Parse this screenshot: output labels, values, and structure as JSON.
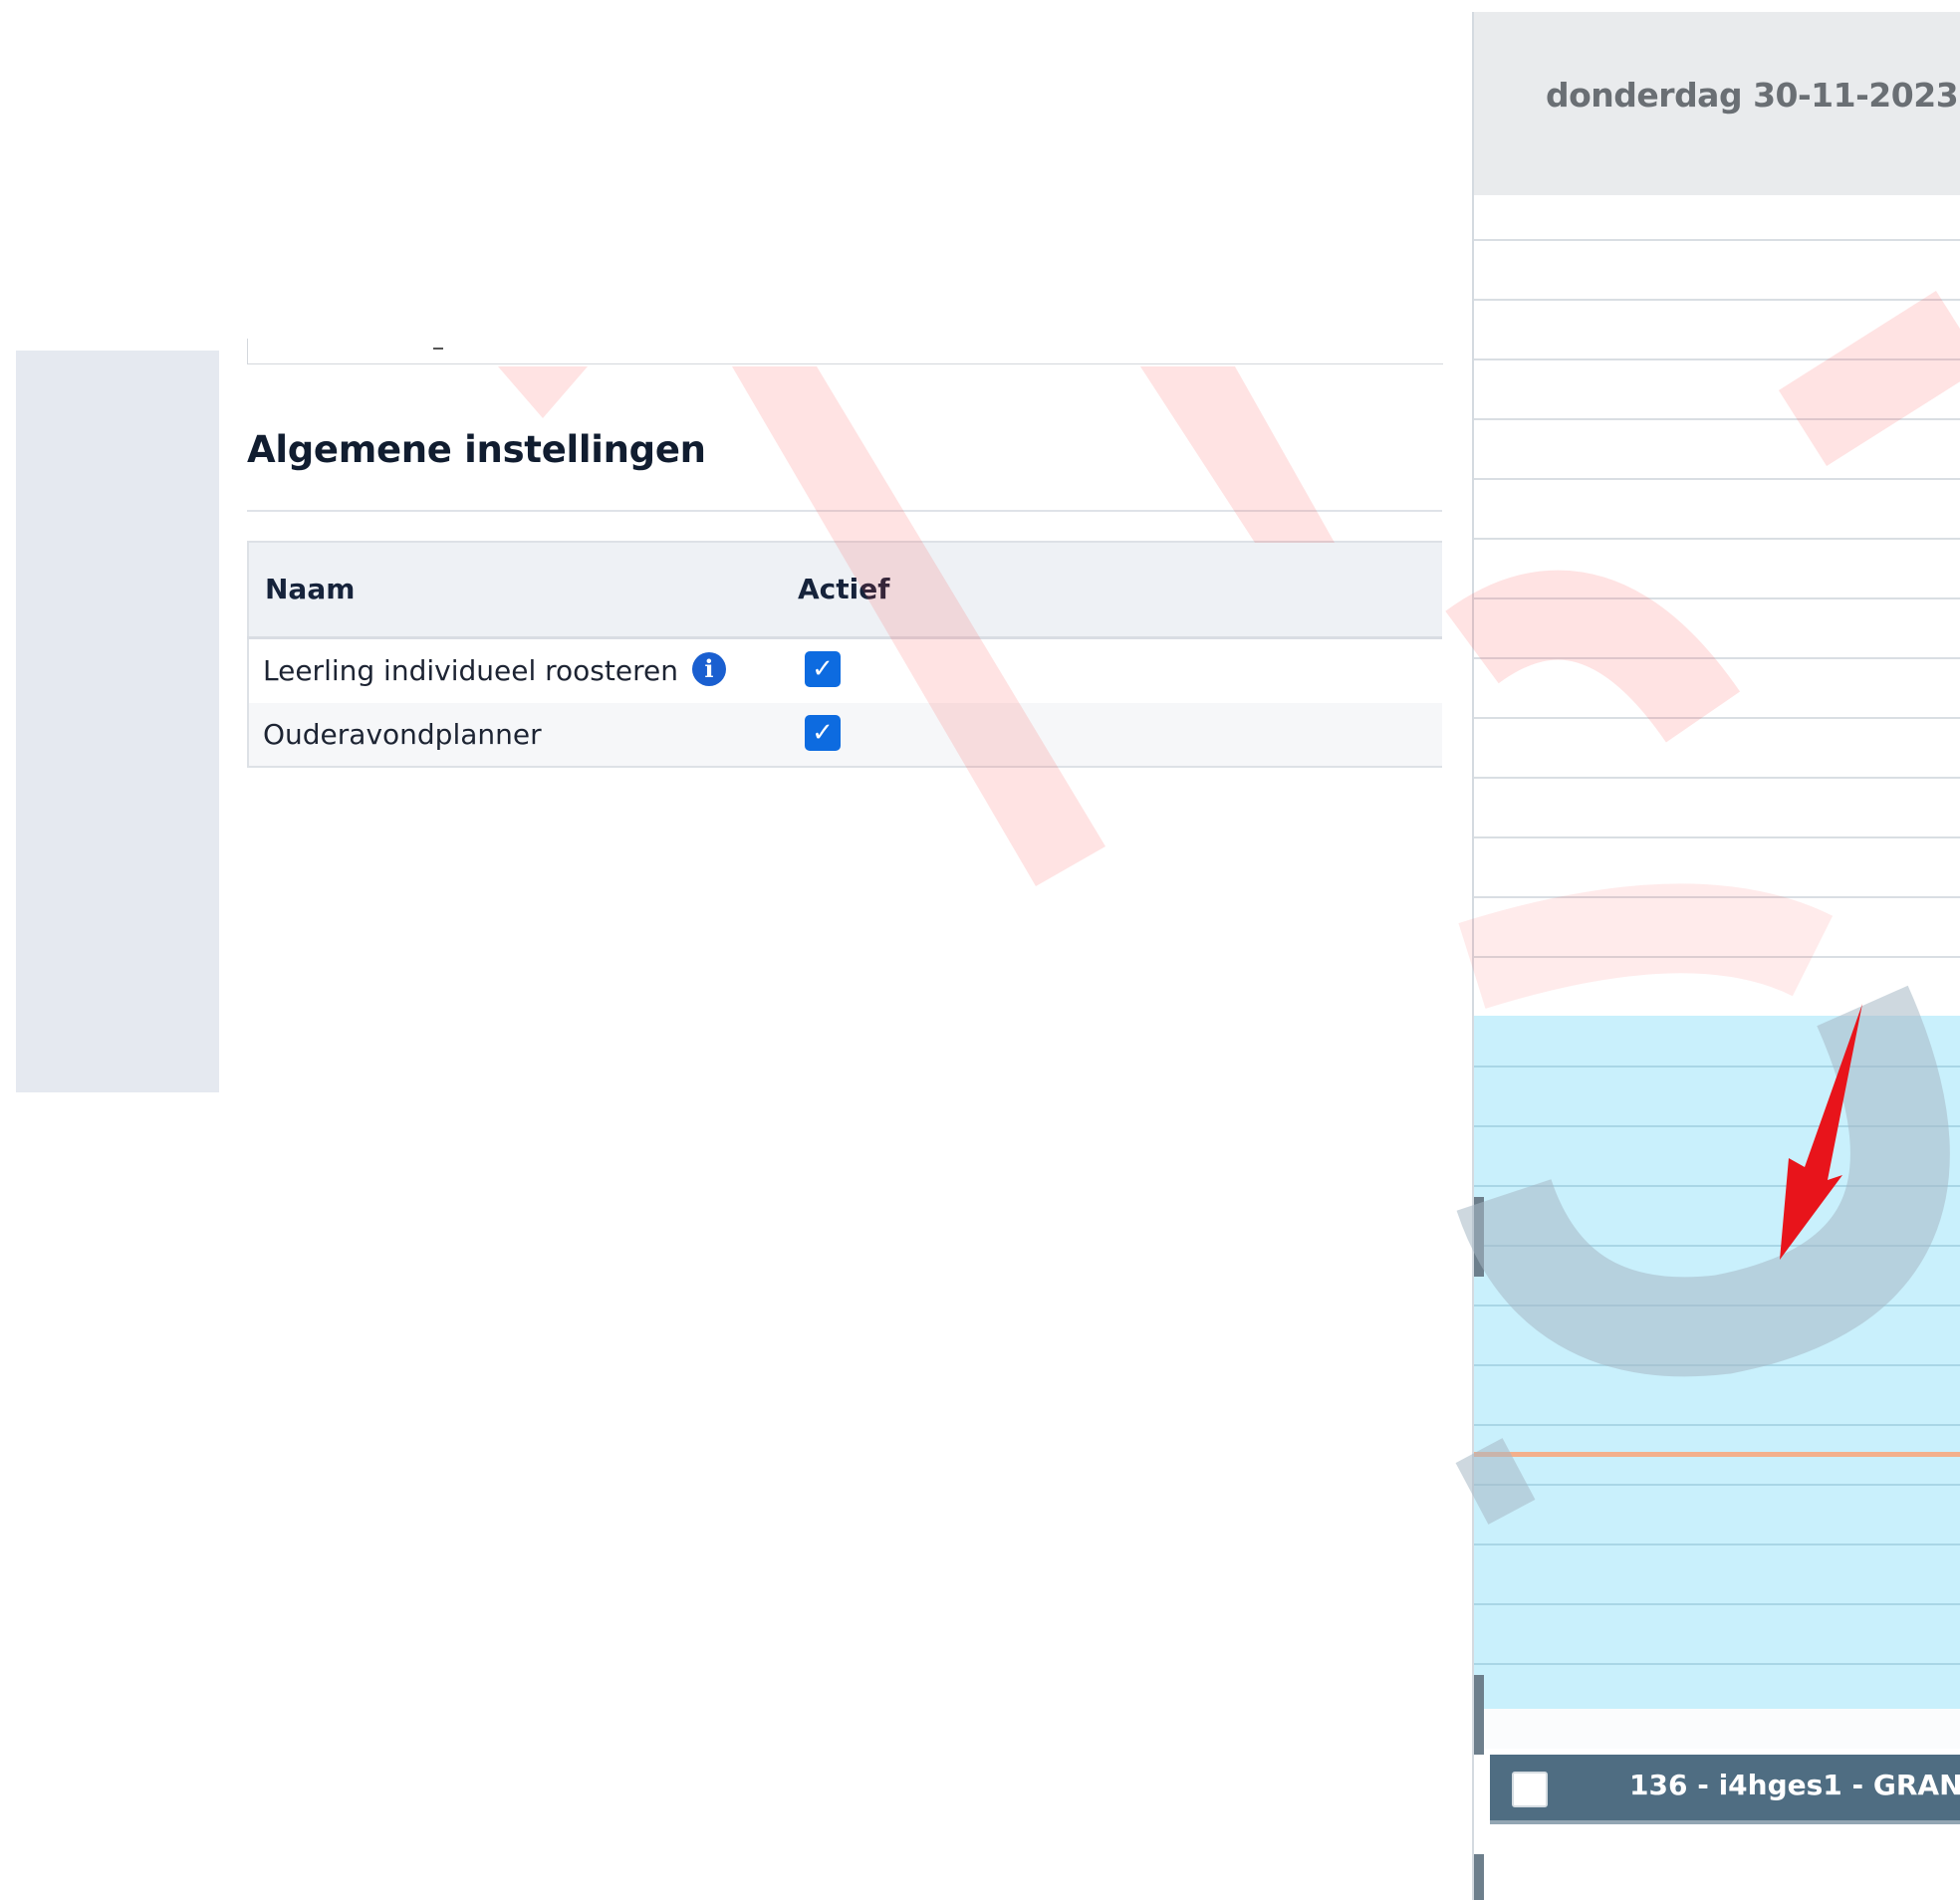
{
  "settings": {
    "title": "Algemene instellingen",
    "columns": {
      "name": "Naam",
      "active": "Actief"
    },
    "rows": [
      {
        "name": "Leerling individueel roosteren",
        "info_icon": "info-icon",
        "active": true
      },
      {
        "name": "Ouderavondplanner",
        "active": true
      }
    ],
    "check_glyph": "✓",
    "info_glyph": "i"
  },
  "calendar": {
    "day_header": "donderdag 30-11-2023",
    "event": {
      "label": "136 - i4hges1 - GRAN",
      "checked": false
    }
  },
  "colors": {
    "checkbox": "#0d6be0",
    "info": "#1a5fd0",
    "availability": "#c9f0fc",
    "event": "#4f6d82",
    "current_time_line": "#f3b08c",
    "annotation_arrow": "#e8141b"
  }
}
